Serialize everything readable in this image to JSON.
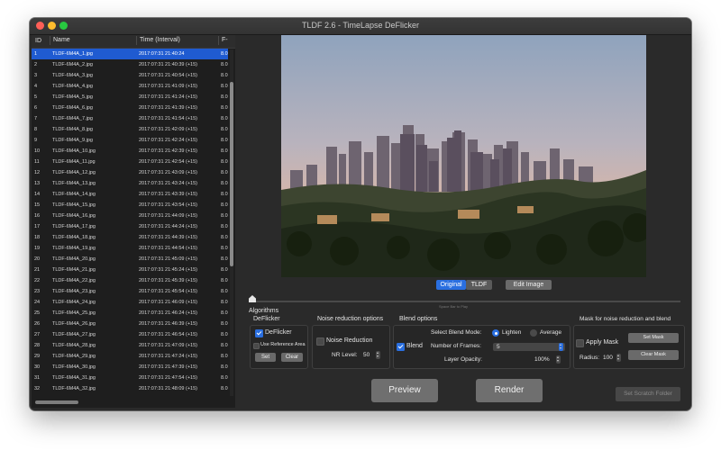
{
  "window": {
    "title": "TLDF 2.6 - TimeLapse DeFlicker"
  },
  "table": {
    "headers": {
      "id": "ID",
      "name": "Name",
      "time": "Time (Interval)",
      "f": "F-"
    },
    "rows": [
      {
        "id": "1",
        "name": "TLDF-6M4A_1.jpg",
        "time": "2017:07:31 21:40:24",
        "f": "8.0"
      },
      {
        "id": "2",
        "name": "TLDF-6M4A_2.jpg",
        "time": "2017:07:31 21:40:39 (+15)",
        "f": "8.0"
      },
      {
        "id": "3",
        "name": "TLDF-6M4A_3.jpg",
        "time": "2017:07:31 21:40:54 (+15)",
        "f": "8.0"
      },
      {
        "id": "4",
        "name": "TLDF-6M4A_4.jpg",
        "time": "2017:07:31 21:41:09 (+15)",
        "f": "8.0"
      },
      {
        "id": "5",
        "name": "TLDF-6M4A_5.jpg",
        "time": "2017:07:31 21:41:24 (+15)",
        "f": "8.0"
      },
      {
        "id": "6",
        "name": "TLDF-6M4A_6.jpg",
        "time": "2017:07:31 21:41:39 (+15)",
        "f": "8.0"
      },
      {
        "id": "7",
        "name": "TLDF-6M4A_7.jpg",
        "time": "2017:07:31 21:41:54 (+15)",
        "f": "8.0"
      },
      {
        "id": "8",
        "name": "TLDF-6M4A_8.jpg",
        "time": "2017:07:31 21:42:09 (+15)",
        "f": "8.0"
      },
      {
        "id": "9",
        "name": "TLDF-6M4A_9.jpg",
        "time": "2017:07:31 21:42:24 (+15)",
        "f": "8.0"
      },
      {
        "id": "10",
        "name": "TLDF-6M4A_10.jpg",
        "time": "2017:07:31 21:42:39 (+15)",
        "f": "8.0"
      },
      {
        "id": "11",
        "name": "TLDF-6M4A_11.jpg",
        "time": "2017:07:31 21:42:54 (+15)",
        "f": "8.0"
      },
      {
        "id": "12",
        "name": "TLDF-6M4A_12.jpg",
        "time": "2017:07:31 21:43:09 (+15)",
        "f": "8.0"
      },
      {
        "id": "13",
        "name": "TLDF-6M4A_13.jpg",
        "time": "2017:07:31 21:43:24 (+15)",
        "f": "8.0"
      },
      {
        "id": "14",
        "name": "TLDF-6M4A_14.jpg",
        "time": "2017:07:31 21:43:39 (+15)",
        "f": "8.0"
      },
      {
        "id": "15",
        "name": "TLDF-6M4A_15.jpg",
        "time": "2017:07:31 21:43:54 (+15)",
        "f": "8.0"
      },
      {
        "id": "16",
        "name": "TLDF-6M4A_16.jpg",
        "time": "2017:07:31 21:44:09 (+15)",
        "f": "8.0"
      },
      {
        "id": "17",
        "name": "TLDF-6M4A_17.jpg",
        "time": "2017:07:31 21:44:24 (+15)",
        "f": "8.0"
      },
      {
        "id": "18",
        "name": "TLDF-6M4A_18.jpg",
        "time": "2017:07:31 21:44:39 (+15)",
        "f": "8.0"
      },
      {
        "id": "19",
        "name": "TLDF-6M4A_19.jpg",
        "time": "2017:07:31 21:44:54 (+15)",
        "f": "8.0"
      },
      {
        "id": "20",
        "name": "TLDF-6M4A_20.jpg",
        "time": "2017:07:31 21:45:09 (+15)",
        "f": "8.0"
      },
      {
        "id": "21",
        "name": "TLDF-6M4A_21.jpg",
        "time": "2017:07:31 21:45:24 (+15)",
        "f": "8.0"
      },
      {
        "id": "22",
        "name": "TLDF-6M4A_22.jpg",
        "time": "2017:07:31 21:45:39 (+15)",
        "f": "8.0"
      },
      {
        "id": "23",
        "name": "TLDF-6M4A_23.jpg",
        "time": "2017:07:31 21:45:54 (+15)",
        "f": "8.0"
      },
      {
        "id": "24",
        "name": "TLDF-6M4A_24.jpg",
        "time": "2017:07:31 21:46:09 (+15)",
        "f": "8.0"
      },
      {
        "id": "25",
        "name": "TLDF-6M4A_25.jpg",
        "time": "2017:07:31 21:46:24 (+15)",
        "f": "8.0"
      },
      {
        "id": "26",
        "name": "TLDF-6M4A_26.jpg",
        "time": "2017:07:31 21:46:39 (+15)",
        "f": "8.0"
      },
      {
        "id": "27",
        "name": "TLDF-6M4A_27.jpg",
        "time": "2017:07:31 21:46:54 (+15)",
        "f": "8.0"
      },
      {
        "id": "28",
        "name": "TLDF-6M4A_28.jpg",
        "time": "2017:07:31 21:47:09 (+15)",
        "f": "8.0"
      },
      {
        "id": "29",
        "name": "TLDF-6M4A_29.jpg",
        "time": "2017:07:31 21:47:24 (+15)",
        "f": "8.0"
      },
      {
        "id": "30",
        "name": "TLDF-6M4A_30.jpg",
        "time": "2017:07:31 21:47:39 (+15)",
        "f": "8.0"
      },
      {
        "id": "31",
        "name": "TLDF-6M4A_31.jpg",
        "time": "2017:07:31 21:47:54 (+15)",
        "f": "8.0"
      },
      {
        "id": "32",
        "name": "TLDF-6M4A_32.jpg",
        "time": "2017:07:31 21:48:09 (+15)",
        "f": "8.0"
      }
    ]
  },
  "preview": {
    "tab_original": "Original",
    "tab_tldf": "TLDF",
    "edit_image": "Edit Image",
    "slider_hint": "Space Bar to Play"
  },
  "algorithms": {
    "section_label": "Algorithms",
    "deflicker": {
      "title": "DeFlicker",
      "checkbox_label": "DeFlicker",
      "use_reference": "Use Reference Area",
      "set": "Set",
      "clear": "Clear"
    },
    "noise": {
      "title": "Noise reduction options",
      "checkbox_label": "Noise Reduction",
      "nr_label": "NR Level:",
      "nr_value": "50"
    },
    "blend": {
      "title": "Blend options",
      "checkbox_label": "Blend",
      "mode_label": "Select Blend Mode:",
      "lighten": "Lighten",
      "average": "Average",
      "frames_label": "Number of Frames:",
      "frames_value": "5",
      "opacity_label": "Layer Opacity:",
      "opacity_value": "100%"
    },
    "mask": {
      "title": "Mask for noise reduction and blend",
      "checkbox_label": "Apply Mask",
      "set_mask": "Set Mask",
      "clear_mask": "Clear Mask",
      "radius_label": "Radius:",
      "radius_value": "100"
    }
  },
  "actions": {
    "preview": "Preview",
    "render": "Render",
    "scratch": "Set Scratch Folder"
  },
  "colors": {
    "accent": "#2a6fe0",
    "selection": "#1f5bd1"
  }
}
